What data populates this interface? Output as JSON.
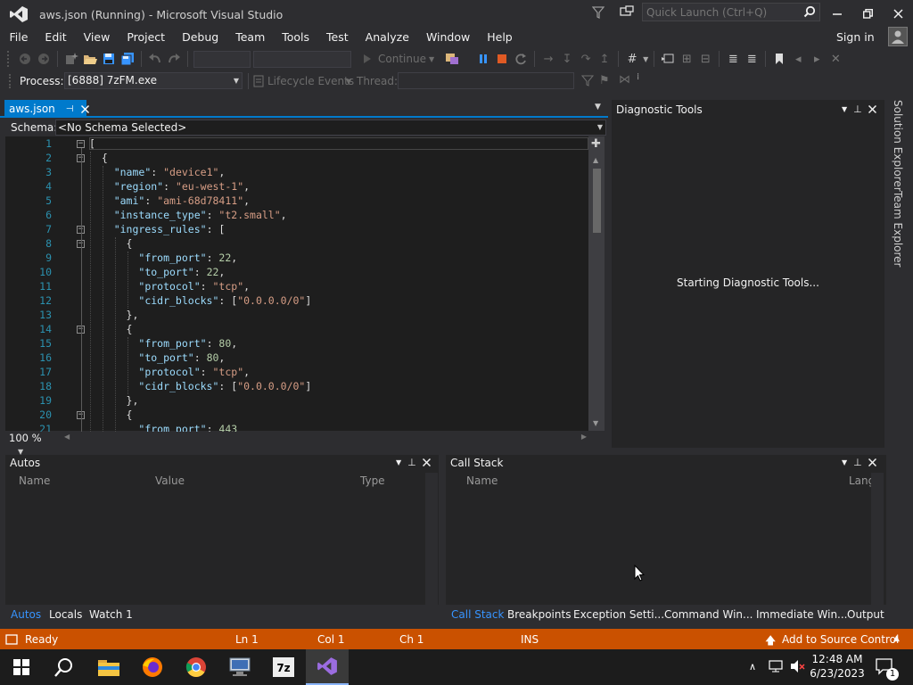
{
  "window": {
    "title": "aws.json (Running) - Microsoft Visual Studio",
    "quick_launch_placeholder": "Quick Launch (Ctrl+Q)",
    "sign_in": "Sign in"
  },
  "menu": [
    "File",
    "Edit",
    "View",
    "Project",
    "Debug",
    "Team",
    "Tools",
    "Test",
    "Analyze",
    "Window",
    "Help"
  ],
  "toolbar": {
    "continue_label": "Continue",
    "process_label": "Process:",
    "process_value": "[6888] 7zFM.exe",
    "lifecycle_label": "Lifecycle Events",
    "thread_label": "Thread:"
  },
  "editor": {
    "tab_label": "aws.json",
    "schema_label": "Schema:",
    "schema_value": "<No Schema Selected>",
    "zoom": "100 %",
    "lines": [
      {
        "n": "1",
        "text": "["
      },
      {
        "n": "2",
        "text": "  {"
      },
      {
        "n": "3",
        "text": "    \"name\": \"device1\","
      },
      {
        "n": "4",
        "text": "    \"region\": \"eu-west-1\","
      },
      {
        "n": "5",
        "text": "    \"ami\": \"ami-68d78411\","
      },
      {
        "n": "6",
        "text": "    \"instance_type\": \"t2.small\","
      },
      {
        "n": "7",
        "text": "    \"ingress_rules\": ["
      },
      {
        "n": "8",
        "text": "      {"
      },
      {
        "n": "9",
        "text": "        \"from_port\": 22,"
      },
      {
        "n": "10",
        "text": "        \"to_port\": 22,"
      },
      {
        "n": "11",
        "text": "        \"protocol\": \"tcp\","
      },
      {
        "n": "12",
        "text": "        \"cidr_blocks\": [\"0.0.0.0/0\"]"
      },
      {
        "n": "13",
        "text": "      },"
      },
      {
        "n": "14",
        "text": "      {"
      },
      {
        "n": "15",
        "text": "        \"from_port\": 80,"
      },
      {
        "n": "16",
        "text": "        \"to_port\": 80,"
      },
      {
        "n": "17",
        "text": "        \"protocol\": \"tcp\","
      },
      {
        "n": "18",
        "text": "        \"cidr_blocks\": [\"0.0.0.0/0\"]"
      },
      {
        "n": "19",
        "text": "      },"
      },
      {
        "n": "20",
        "text": "      {"
      },
      {
        "n": "21",
        "text": "        \"from_port\": 443"
      }
    ],
    "fold_lines": [
      "1",
      "2",
      "7",
      "8",
      "14",
      "20"
    ]
  },
  "diagnostic": {
    "title": "Diagnostic Tools",
    "message": "Starting Diagnostic Tools..."
  },
  "side_tabs": [
    "Solution Explorer",
    "Team Explorer"
  ],
  "autos": {
    "title": "Autos",
    "columns": [
      "Name",
      "Value",
      "Type"
    ],
    "tabs": [
      "Autos",
      "Locals",
      "Watch 1"
    ]
  },
  "callstack": {
    "title": "Call Stack",
    "columns": [
      "Name",
      "Lang"
    ],
    "tabs": [
      "Call Stack",
      "Breakpoints",
      "Exception Setti...",
      "Command Win...",
      "Immediate Win...",
      "Output"
    ]
  },
  "status": {
    "ready": "Ready",
    "ln": "Ln 1",
    "col": "Col 1",
    "ch": "Ch 1",
    "ins": "INS",
    "source_control": "Add to Source Control"
  },
  "taskbar": {
    "time": "12:48 AM",
    "date": "6/23/2023",
    "notification_count": "1"
  },
  "colors": {
    "accent": "#007acc",
    "status_debug": "#ca5100",
    "editor_bg": "#1e1e1e"
  }
}
